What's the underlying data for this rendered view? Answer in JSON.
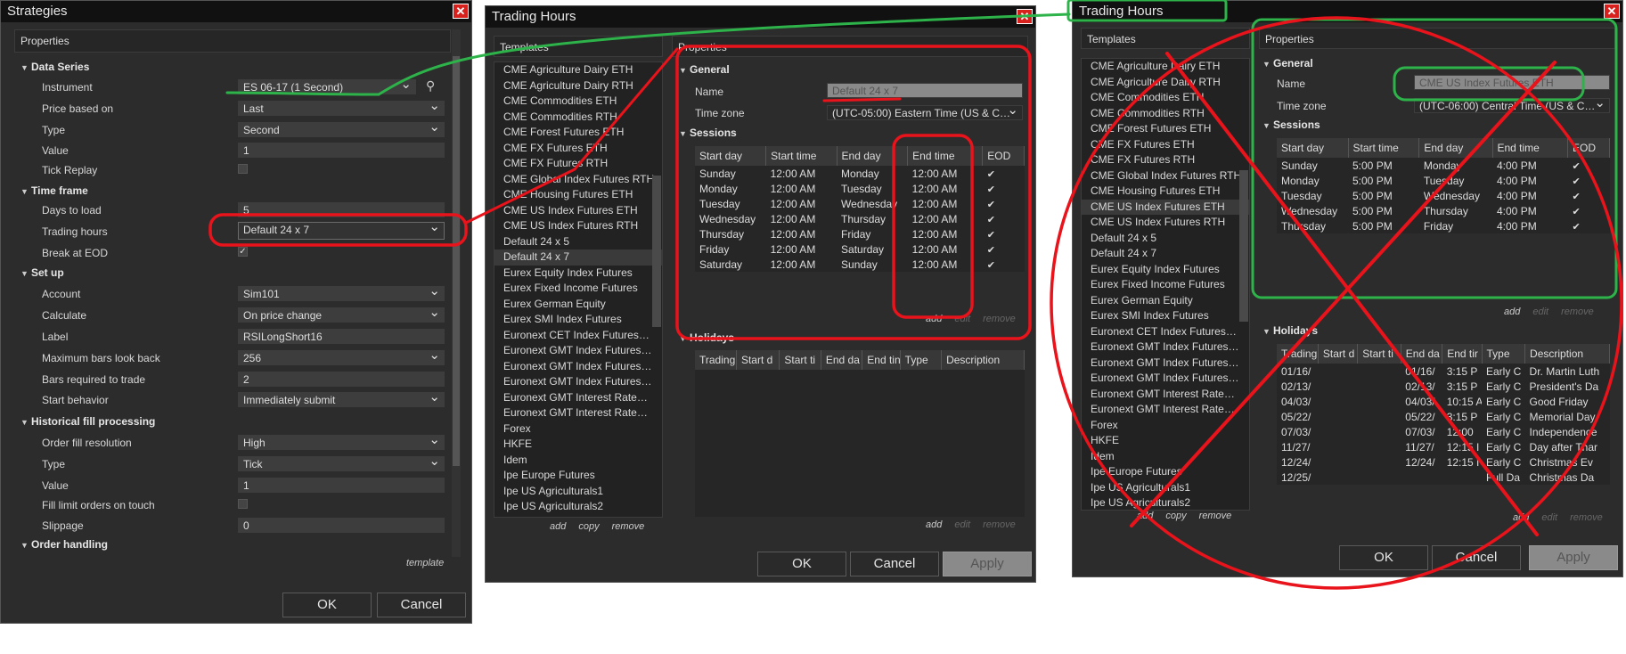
{
  "strategies": {
    "title": "Strategies",
    "properties_label": "Properties",
    "sections": {
      "data_series": "Data Series",
      "time_frame": "Time frame",
      "set_up": "Set up",
      "historical": "Historical fill processing",
      "order_handling": "Order handling"
    },
    "rows": {
      "instrument": {
        "label": "Instrument",
        "value": "ES 06-17 (1 Second)"
      },
      "price_based_on": {
        "label": "Price based on",
        "value": "Last"
      },
      "type": {
        "label": "Type",
        "value": "Second"
      },
      "value": {
        "label": "Value",
        "value": "1"
      },
      "tick_replay": {
        "label": "Tick Replay"
      },
      "days_to_load": {
        "label": "Days to load",
        "value": "5"
      },
      "trading_hours": {
        "label": "Trading hours",
        "value": "Default 24 x 7"
      },
      "break_at_eod": {
        "label": "Break at EOD"
      },
      "account": {
        "label": "Account",
        "value": "Sim101"
      },
      "calculate": {
        "label": "Calculate",
        "value": "On price change"
      },
      "label": {
        "label": "Label",
        "value": "RSILongShort16"
      },
      "max_bars": {
        "label": "Maximum bars look back",
        "value": "256"
      },
      "bars_required": {
        "label": "Bars required to trade",
        "value": "2"
      },
      "start_behavior": {
        "label": "Start behavior",
        "value": "Immediately submit"
      },
      "order_fill": {
        "label": "Order fill resolution",
        "value": "High"
      },
      "hist_type": {
        "label": "Type",
        "value": "Tick"
      },
      "hist_value": {
        "label": "Value",
        "value": "1"
      },
      "fill_limit": {
        "label": "Fill limit orders on touch"
      },
      "slippage": {
        "label": "Slippage",
        "value": "0"
      }
    },
    "template_link": "template",
    "ok": "OK",
    "cancel": "Cancel"
  },
  "th1": {
    "title": "Trading Hours",
    "templates_label": "Templates",
    "properties_label": "Properties",
    "templates": [
      "CME Agriculture Dairy ETH",
      "CME Agriculture Dairy RTH",
      "CME Commodities ETH",
      "CME Commodities RTH",
      "CME Forest Futures ETH",
      "CME FX Futures ETH",
      "CME FX Futures RTH",
      "CME Global Index Futures RTH",
      "CME Housing Futures ETH",
      "CME US Index Futures ETH",
      "CME US Index Futures RTH",
      "Default 24 x 5",
      "Default 24 x 7",
      "Eurex Equity Index Futures",
      "Eurex Fixed Income Futures",
      "Eurex German Equity",
      "Eurex SMI Index Futures",
      "Euronext CET Index Futures…",
      "Euronext GMT Index Futures…",
      "Euronext GMT Index Futures…",
      "Euronext GMT Index Futures…",
      "Euronext GMT Interest Rate…",
      "Euronext GMT Interest Rate…",
      "Forex",
      "HKFE",
      "Idem",
      "Ipe Europe Futures",
      "Ipe US Agriculturals1",
      "Ipe US Agriculturals2"
    ],
    "list_links": {
      "add": "add",
      "copy": "copy",
      "remove": "remove"
    },
    "general": "General",
    "name_label": "Name",
    "name_value": "Default 24 x 7",
    "tz_label": "Time zone",
    "tz_value": "(UTC-05:00) Eastern Time (US & C…",
    "sessions": "Sessions",
    "session_headers": [
      "Start day",
      "Start time",
      "End day",
      "End time",
      "EOD"
    ],
    "session_rows": [
      [
        "Sunday",
        "12:00 AM",
        "Monday",
        "12:00 AM"
      ],
      [
        "Monday",
        "12:00 AM",
        "Tuesday",
        "12:00 AM"
      ],
      [
        "Tuesday",
        "12:00 AM",
        "Wednesday",
        "12:00 AM"
      ],
      [
        "Wednesday",
        "12:00 AM",
        "Thursday",
        "12:00 AM"
      ],
      [
        "Thursday",
        "12:00 AM",
        "Friday",
        "12:00 AM"
      ],
      [
        "Friday",
        "12:00 AM",
        "Saturday",
        "12:00 AM"
      ],
      [
        "Saturday",
        "12:00 AM",
        "Sunday",
        "12:00 AM"
      ]
    ],
    "session_links": {
      "add": "add",
      "edit": "edit",
      "remove": "remove"
    },
    "holidays": "Holidays",
    "holiday_headers": [
      "Trading",
      "Start d",
      "Start ti",
      "End da",
      "End tin",
      "Type",
      "Description"
    ],
    "holiday_links": {
      "add": "add",
      "edit": "edit",
      "remove": "remove"
    },
    "ok": "OK",
    "cancel": "Cancel",
    "apply": "Apply"
  },
  "th2": {
    "title": "Trading Hours",
    "templates_label": "Templates",
    "properties_label": "Properties",
    "templates": [
      "CME Agriculture Dairy ETH",
      "CME Agriculture Dairy RTH",
      "CME Commodities ETH",
      "CME Commodities RTH",
      "CME Forest Futures ETH",
      "CME FX Futures ETH",
      "CME FX Futures RTH",
      "CME Global Index Futures RTH",
      "CME Housing Futures ETH",
      "CME US Index Futures ETH",
      "CME US Index Futures RTH",
      "Default 24 x 5",
      "Default 24 x 7",
      "Eurex Equity Index Futures",
      "Eurex Fixed Income Futures",
      "Eurex German Equity",
      "Eurex SMI Index Futures",
      "Euronext CET Index Futures…",
      "Euronext GMT Index Futures…",
      "Euronext GMT Index Futures…",
      "Euronext GMT Index Futures…",
      "Euronext GMT Interest Rate…",
      "Euronext GMT Interest Rate…",
      "Forex",
      "HKFE",
      "Idem",
      "Ipe Europe Futures",
      "Ipe US Agriculturals1",
      "Ipe US Agriculturals2"
    ],
    "list_links": {
      "add": "add",
      "copy": "copy",
      "remove": "remove"
    },
    "general": "General",
    "name_label": "Name",
    "name_value": "CME US Index Futures ETH",
    "tz_label": "Time zone",
    "tz_value": "(UTC-06:00) Central Time (US & C…",
    "sessions": "Sessions",
    "session_headers": [
      "Start day",
      "Start time",
      "End day",
      "End time",
      "EOD"
    ],
    "session_rows": [
      [
        "Sunday",
        "5:00 PM",
        "Monday",
        "4:00 PM"
      ],
      [
        "Monday",
        "5:00 PM",
        "Tuesday",
        "4:00 PM"
      ],
      [
        "Tuesday",
        "5:00 PM",
        "Wednesday",
        "4:00 PM"
      ],
      [
        "Wednesday",
        "5:00 PM",
        "Thursday",
        "4:00 PM"
      ],
      [
        "Thursday",
        "5:00 PM",
        "Friday",
        "4:00 PM"
      ]
    ],
    "session_links": {
      "add": "add",
      "edit": "edit",
      "remove": "remove"
    },
    "holidays": "Holidays",
    "holiday_headers": [
      "Trading",
      "Start d",
      "Start ti",
      "End da",
      "End tir",
      "Type",
      "Description"
    ],
    "holiday_rows": [
      [
        "01/16/",
        "",
        "",
        "01/16/",
        "3:15 P",
        "Early C",
        "Dr. Martin Luth"
      ],
      [
        "02/13/",
        "",
        "",
        "02/13/",
        "3:15 P",
        "Early C",
        "President's Da"
      ],
      [
        "04/03/",
        "",
        "",
        "04/03/",
        "10:15 A",
        "Early C",
        "Good Friday"
      ],
      [
        "05/22/",
        "",
        "",
        "05/22/",
        "3:15 P",
        "Early C",
        "Memorial Day"
      ],
      [
        "07/03/",
        "",
        "",
        "07/03/",
        "12:00",
        "Early C",
        "Independence"
      ],
      [
        "11/27/",
        "",
        "",
        "11/27/",
        "12:15 I",
        "Early C",
        "Day after Thar"
      ],
      [
        "12/24/",
        "",
        "",
        "12/24/",
        "12:15 I",
        "Early C",
        "Christmas Ev"
      ],
      [
        "12/25/",
        "",
        "",
        "",
        "",
        "Full Da",
        "Christmas Da"
      ]
    ],
    "holiday_links": {
      "add": "add",
      "edit": "edit",
      "remove": "remove"
    },
    "ok": "OK",
    "cancel": "Cancel",
    "apply": "Apply"
  },
  "colors": {
    "annotation_red": "#e8131b",
    "annotation_green": "#2db34a",
    "dialog_bg": "#2c2c2c",
    "title_bg": "#111111"
  }
}
